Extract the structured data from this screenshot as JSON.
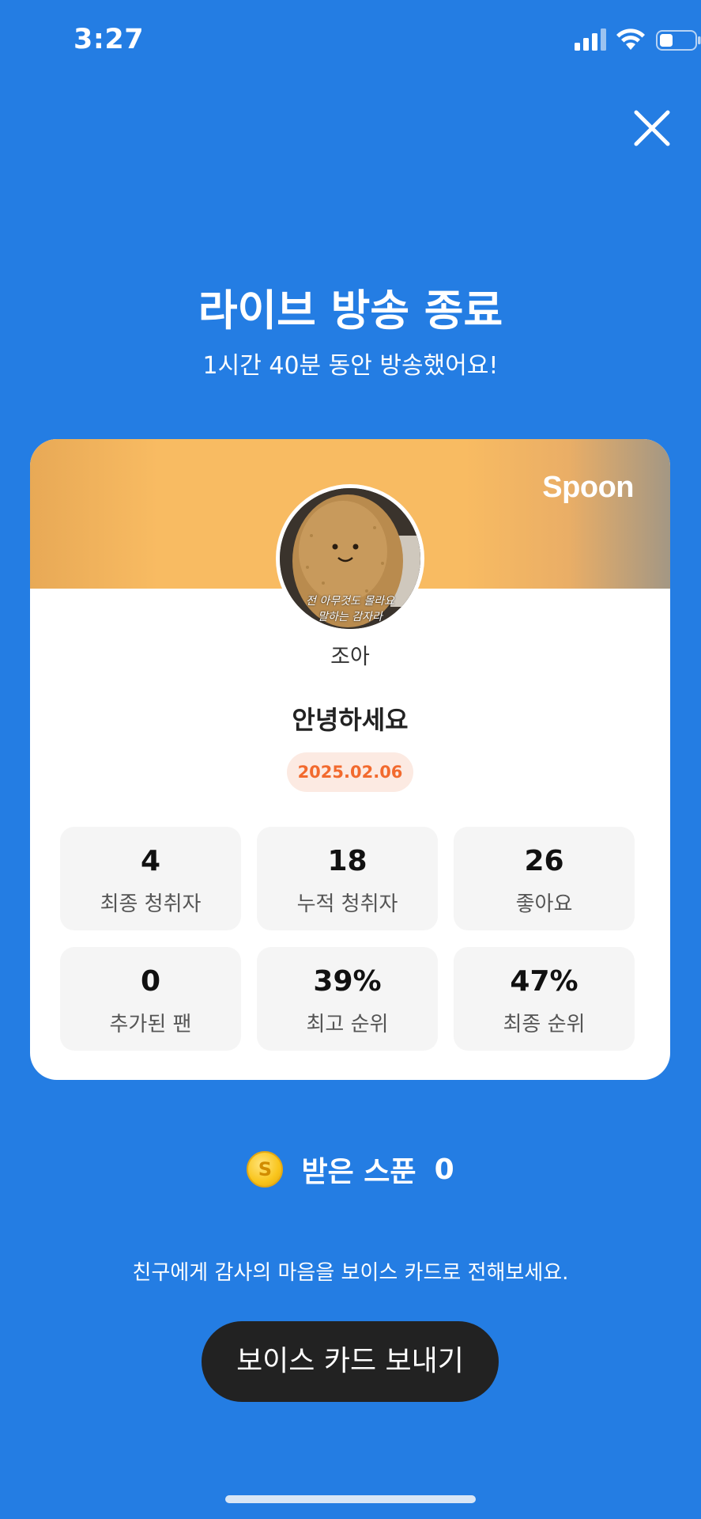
{
  "status_bar": {
    "time": "3:27",
    "icons": [
      "cellular-signal-icon",
      "wifi-icon",
      "battery-icon"
    ]
  },
  "header": {
    "close_icon": "close-icon",
    "title": "라이브 방송 종료",
    "subtitle": "1시간 40분 동안 방송했어요!"
  },
  "card": {
    "brand": "Spoon",
    "avatar_caption_line1": "전 아무것도 몰라요",
    "avatar_caption_line2": "말하는 감자라",
    "username": "조아",
    "broadcast_title": "안녕하세요",
    "date": "2025.02.06",
    "stats": [
      {
        "value": "4",
        "label": "최종 청취자"
      },
      {
        "value": "18",
        "label": "누적 청취자"
      },
      {
        "value": "26",
        "label": "좋아요"
      },
      {
        "value": "0",
        "label": "추가된 팬"
      },
      {
        "value": "39%",
        "label": "최고 순위"
      },
      {
        "value": "47%",
        "label": "최종 순위"
      }
    ]
  },
  "spoons": {
    "coin_icon": "spoon-coin-icon",
    "coin_symbol": "S",
    "label": "받은 스푼",
    "count": "0"
  },
  "footer": {
    "hint": "친구에게 감사의 마음을 보이스 카드로 전해보세요.",
    "button_label": "보이스 카드 보내기"
  },
  "colors": {
    "background": "#247DE3",
    "badge_text": "#F26A2E",
    "badge_bg": "#FCEAE2",
    "button_bg": "#222222"
  }
}
